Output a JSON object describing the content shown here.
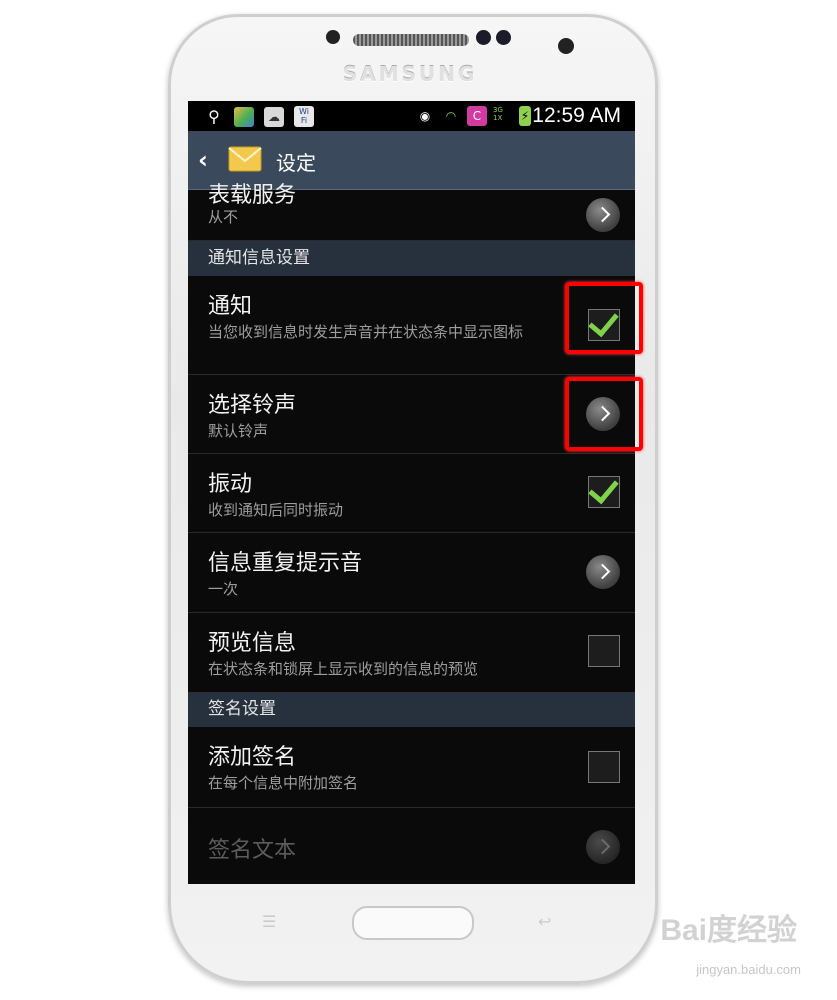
{
  "device": {
    "brand": "SAMSUNG"
  },
  "status_bar": {
    "time": "12:59 AM",
    "left_icons": [
      "usb-icon",
      "photo-app-icon",
      "weather-icon",
      "wifi-direct-icon"
    ],
    "right_icons": [
      "eye-icon",
      "wifi-icon",
      "carrier-icon",
      "signal-icon",
      "battery-charging-icon"
    ],
    "wifi_direct_label": "Wi\nFi",
    "carrier_label": "C",
    "network_label": "3G\n1X"
  },
  "action_bar": {
    "title": "设定",
    "back_icon": "chevron-left-icon",
    "app_icon": "envelope-icon"
  },
  "top_item": {
    "title": "表载服务",
    "subtitle": "从不"
  },
  "sections": {
    "notification": "通知信息设置",
    "signature": "签名设置"
  },
  "items": {
    "notify": {
      "title": "通知",
      "subtitle": "当您收到信息时发生声音并在状态条中显示图标",
      "checked": true
    },
    "ringtone": {
      "title": "选择铃声",
      "subtitle": "默认铃声"
    },
    "vibrate": {
      "title": "振动",
      "subtitle": "收到通知后同时振动",
      "checked": true
    },
    "repeat": {
      "title": "信息重复提示音",
      "subtitle": "一次"
    },
    "preview": {
      "title": "预览信息",
      "subtitle": "在状态条和锁屏上显示收到的信息的预览",
      "checked": false
    },
    "add_signature": {
      "title": "添加签名",
      "subtitle": "在每个信息中附加签名",
      "checked": false
    },
    "signature_text": {
      "title": "签名文本",
      "enabled": false
    }
  },
  "watermark": {
    "logo": "Bai度经验",
    "url": "jingyan.baidu.com"
  },
  "colors": {
    "highlight": "#ff0000",
    "check": "#7fd24a",
    "actionbar": "#3a4a5c",
    "section": "#27313d"
  }
}
